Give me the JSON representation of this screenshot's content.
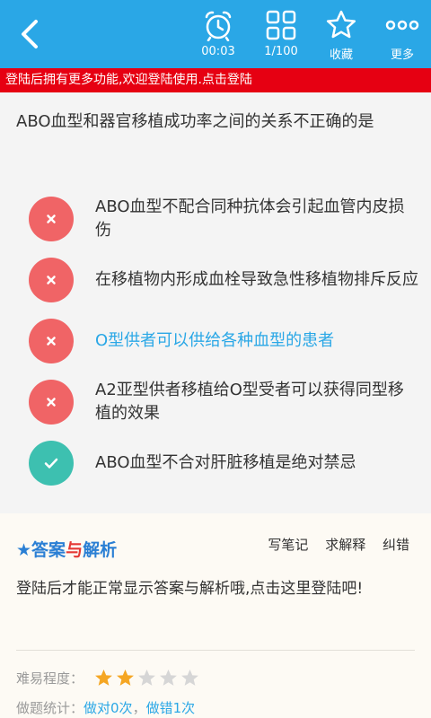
{
  "toolbar": {
    "timer": "00:03",
    "progress": "1/100",
    "favorite": "收藏",
    "more": "更多"
  },
  "banner": "登陆后拥有更多功能,欢迎登陆使用.点击登陆",
  "question": "ABO血型和器官移植成功率之间的关系不正确的是",
  "options": [
    {
      "text": "ABO血型不配合同种抗体会引起血管内皮损伤",
      "status": "wrong"
    },
    {
      "text": "在移植物内形成血栓导致急性移植物排斥反应",
      "status": "wrong"
    },
    {
      "text": "O型供者可以供给各种血型的患者",
      "status": "wrong",
      "selected": true
    },
    {
      "text": "A2亚型供者移植给O型受者可以获得同型移植的效果",
      "status": "wrong"
    },
    {
      "text": "ABO血型不合对肝脏移植是绝对禁忌",
      "status": "right"
    }
  ],
  "answer": {
    "heading_a": "答案",
    "heading_join": "与",
    "heading_b": "解析",
    "actions": {
      "note": "写笔记",
      "ask": "求解释",
      "report": "纠错"
    },
    "message": "登陆后才能正常显示答案与解析哦,点击这里登陆吧!",
    "difficulty_label": "难易程度：",
    "difficulty_rating": 2,
    "difficulty_max": 5,
    "stats_label": "做题统计：",
    "stats_right": "做对0次",
    "stats_sep": "，",
    "stats_wrong": "做错1次"
  },
  "colors": {
    "primary": "#2aa7e6",
    "banner": "#e60012",
    "wrong": "#f06466",
    "right": "#3dc0b0",
    "star_on": "#f5a623",
    "star_off": "#d6d6d6"
  }
}
